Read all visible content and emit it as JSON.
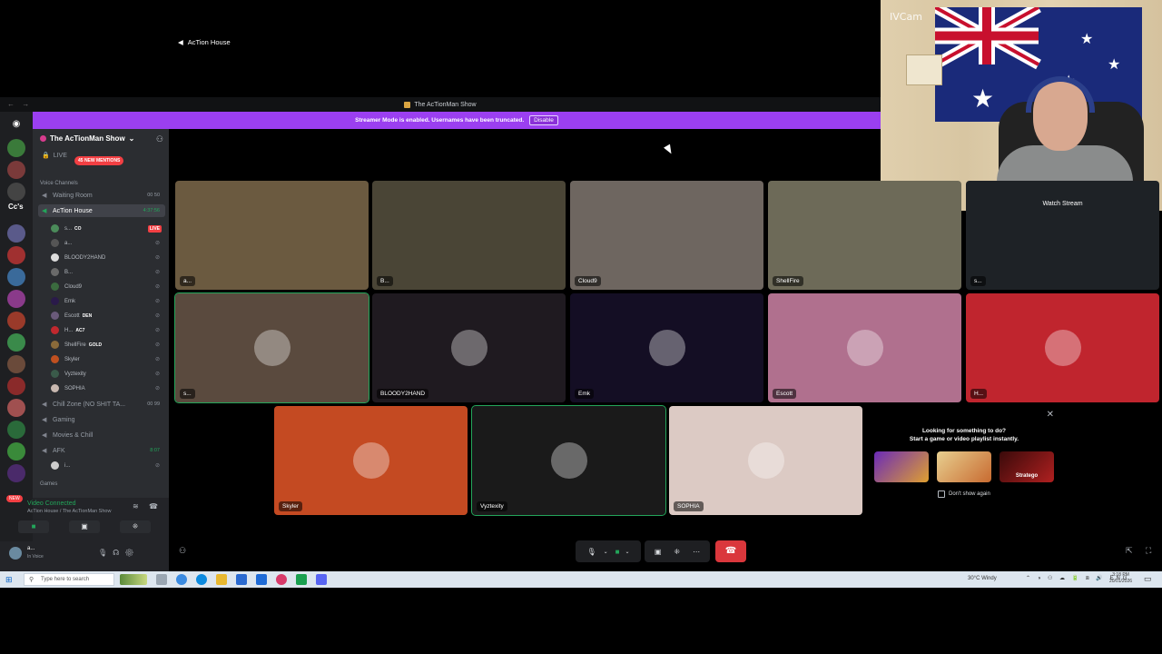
{
  "window": {
    "title": "The AcTionMan Show",
    "banner_text": "Streamer Mode is enabled. Usernames have been truncated.",
    "banner_button": "Disable"
  },
  "rail": {
    "label": "Cc's",
    "new_badge": "NEW"
  },
  "sidebar": {
    "server_name": "The AcTionMan Show",
    "live_label": "LIVE",
    "mentions_badge": "45 NEW MENTIONS",
    "voice_category": "Voice Channels",
    "games_category": "Games",
    "channels": [
      {
        "name": "Waiting Room",
        "right": "00 50"
      },
      {
        "name": "AcTion House",
        "right": "4:37:56"
      },
      {
        "name": "Chill Zone (NO SHIT TA...",
        "right": "00 99"
      },
      {
        "name": "Gaming",
        "right": ""
      },
      {
        "name": "Movies & Chill",
        "right": ""
      },
      {
        "name": "AFK",
        "right": "8:07"
      }
    ],
    "voice_users": [
      {
        "name": "s...",
        "tag": "CO",
        "live": "LIVE",
        "color": "#4b8b5a"
      },
      {
        "name": "a...",
        "tag": "",
        "live": "",
        "color": "#555"
      },
      {
        "name": "BLOODY2HAND",
        "tag": "",
        "live": "",
        "color": "#ddd"
      },
      {
        "name": "B...",
        "tag": "",
        "live": "",
        "color": "#6a6a6a"
      },
      {
        "name": "Cloud9",
        "tag": "",
        "live": "",
        "color": "#3b6b3f"
      },
      {
        "name": "Emk",
        "tag": "",
        "live": "",
        "color": "#2a1a4a"
      },
      {
        "name": "Escott",
        "tag": "DEN",
        "live": "",
        "color": "#6a5a7a"
      },
      {
        "name": "H...",
        "tag": "AC7",
        "live": "",
        "color": "#c0282e"
      },
      {
        "name": "ShellFire",
        "tag": "GOLD",
        "live": "",
        "color": "#8a6a3a"
      },
      {
        "name": "Skyler",
        "tag": "",
        "live": "",
        "color": "#c05020"
      },
      {
        "name": "Vyztexity",
        "tag": "",
        "live": "",
        "color": "#3a5a4a"
      },
      {
        "name": "SOPHIA",
        "tag": "",
        "live": "",
        "color": "#c8b8b0"
      }
    ],
    "afk_user": "i...",
    "voice_connected": "Video Connected",
    "voice_location": "AcTion House / The AcTionMan Show",
    "me_name": "a...",
    "me_status": "In Voice"
  },
  "stage": {
    "channel_title": "AcTion House",
    "tiles": [
      {
        "name": "a...",
        "bg": "#6b5a40"
      },
      {
        "name": "B...",
        "bg": "#4a4536"
      },
      {
        "name": "Cloud9",
        "bg": "#6e6660"
      },
      {
        "name": "ShellFire",
        "bg": "#6d6a58"
      },
      {
        "name": "s...",
        "bg": "#1e2226",
        "action": "Watch Stream"
      },
      {
        "name": "s...",
        "bg": "#5a4a3e"
      },
      {
        "name": "BLOODY2HAND",
        "bg": "#1f1a20"
      },
      {
        "name": "Emk",
        "bg": "#140e24"
      },
      {
        "name": "Escott",
        "bg": "#b0708e"
      },
      {
        "name": "H...",
        "bg": "#c0252e"
      },
      {
        "name": "Skyler",
        "bg": "#c44a22"
      },
      {
        "name": "Vyztexity",
        "bg": "#1a1a1a"
      },
      {
        "name": "SOPHIA",
        "bg": "#dccac4"
      }
    ],
    "activity": {
      "line1": "Looking for something to do?",
      "line2": "Start a game or video playlist instantly.",
      "games": [
        "",
        "",
        "Stratego"
      ],
      "dont_show": "Don't show again"
    }
  },
  "webcam": {
    "label": "IVCam"
  },
  "taskbar": {
    "search_placeholder": "Type here to search",
    "weather": "30°C  Windy",
    "lang": "ENG",
    "time": "3:18 PM",
    "date": "20/01/2026"
  }
}
